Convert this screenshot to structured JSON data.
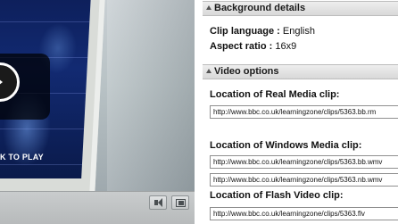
{
  "player": {
    "overlay_label": "K TO PLAY",
    "controls": {
      "volume_icon": "speaker-icon",
      "fullscreen_icon": "fullscreen-icon"
    }
  },
  "background_details": {
    "title": "Background details",
    "clip_language_label": "Clip language :",
    "clip_language_value": "English",
    "aspect_ratio_label": "Aspect ratio :",
    "aspect_ratio_value": "16x9"
  },
  "video_options": {
    "title": "Video options",
    "real_media_label": "Location of Real Media clip:",
    "real_media_urls": [
      "http://www.bbc.co.uk/learningzone/clips/5363.bb.rm"
    ],
    "windows_media_label": "Location of Windows Media clip:",
    "windows_media_urls": [
      "http://www.bbc.co.uk/learningzone/clips/5363.bb.wmv",
      "http://www.bbc.co.uk/learningzone/clips/5363.nb.wmv"
    ],
    "flash_label": "Location of Flash Video clip:",
    "flash_urls": [
      "http://www.bbc.co.uk/learningzone/clips/5363.flv"
    ]
  }
}
